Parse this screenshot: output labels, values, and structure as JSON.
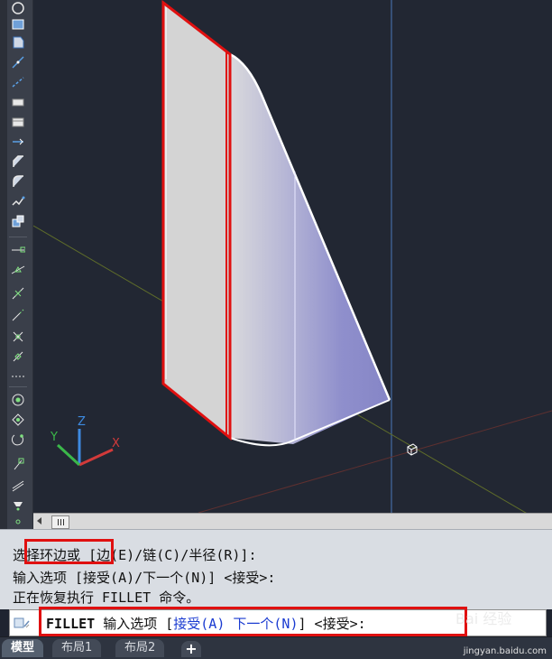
{
  "history": {
    "line1_prefix": "选",
    "line1_highlight": "择环边或",
    "line1_rest": "[边(E)/链(C)/半径(R)]:",
    "line2": "输入选项 [接受(A)/下一个(N)] <接受>:",
    "line3": "正在恢复执行 FILLET 命令。"
  },
  "command": {
    "keyword": "FILLET",
    "label": " 输入选项 [",
    "opt1": "接受(A)",
    "sep1": " ",
    "opt2": "下一个(N)",
    "close": "] <接受>:"
  },
  "tabs": [
    "模型",
    "布局1",
    "布局2"
  ],
  "tab_add": "+",
  "watermark": {
    "site": "jingyan.baidu.com",
    "brand": "Bai 经验"
  },
  "ucs": {
    "x": "X",
    "y": "Y",
    "z": "Z"
  },
  "colors": {
    "viewport_bg": "#222733",
    "highlight": "#e01010",
    "face_light": "#d3d3d3",
    "face_blue": "#8787c8"
  },
  "icons": [
    "circle-icon",
    "rectangle-icon",
    "region-icon",
    "line-icon",
    "xline-icon",
    "box-icon",
    "cylinder-icon",
    "extend-icon",
    "chamfer-icon",
    "fillet-icon",
    "explode-icon",
    "solid-edit-icon",
    "snap-endpoint-icon",
    "snap-midpoint-icon",
    "snap-intersection-icon",
    "snap-extension-icon",
    "snap-center-icon",
    "snap-quadrant-icon",
    "snap-tangent-icon",
    "snap-perpendicular-icon",
    "snap-parallel-icon",
    "snap-insert-icon",
    "snap-node-icon",
    "snap-nearest-icon",
    "snap-none-icon",
    "snap-settings-icon"
  ]
}
